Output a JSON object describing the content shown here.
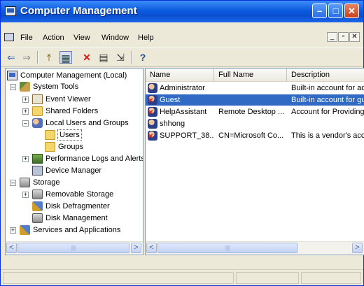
{
  "window": {
    "title": "Computer Management"
  },
  "titlebar_buttons": {
    "minimize": "–",
    "maximize": "□",
    "close": "✕"
  },
  "menu": {
    "items": [
      "File",
      "Action",
      "View",
      "Window",
      "Help"
    ],
    "mdi_minimize": "_",
    "mdi_restore": "▫",
    "mdi_close": "✕"
  },
  "toolbar": {
    "back": "⇐",
    "forward": "⇒",
    "up": "⤒",
    "show_hide": "▦",
    "delete": "✕",
    "properties": "▤",
    "export": "⇲",
    "help": "?"
  },
  "tree": {
    "root": "Computer Management (Local)",
    "system_tools": "System Tools",
    "event_viewer": "Event Viewer",
    "shared_folders": "Shared Folders",
    "local_users": "Local Users and Groups",
    "users": "Users",
    "groups": "Groups",
    "perf_logs": "Performance Logs and Alerts",
    "device_manager": "Device Manager",
    "storage": "Storage",
    "removable_storage": "Removable Storage",
    "disk_defrag": "Disk Defragmenter",
    "disk_management": "Disk Management",
    "services_apps": "Services and Applications",
    "expander_plus": "+",
    "expander_minus": "–"
  },
  "list": {
    "columns": [
      "Name",
      "Full Name",
      "Description"
    ],
    "rows": [
      {
        "name": "Administrator",
        "full_name": "",
        "description": "Built-in account for ad",
        "selected": false,
        "disabled": false
      },
      {
        "name": "Guest",
        "full_name": "",
        "description": "Built-in account for gu",
        "selected": true,
        "disabled": true
      },
      {
        "name": "HelpAssistant",
        "full_name": "Remote Desktop ...",
        "description": "Account for Providing",
        "selected": false,
        "disabled": true
      },
      {
        "name": "shhong",
        "full_name": "",
        "description": "",
        "selected": false,
        "disabled": false
      },
      {
        "name": "SUPPORT_38...",
        "full_name": "CN=Microsoft Co...",
        "description": "This is a vendor's acc",
        "selected": false,
        "disabled": true
      }
    ]
  },
  "scroll": {
    "left": "<",
    "right": ">",
    "grip": "|||"
  },
  "colors": {
    "titlebar": "#0b5be0",
    "selection": "#316ac5",
    "disabled_badge": "#e0221a"
  }
}
